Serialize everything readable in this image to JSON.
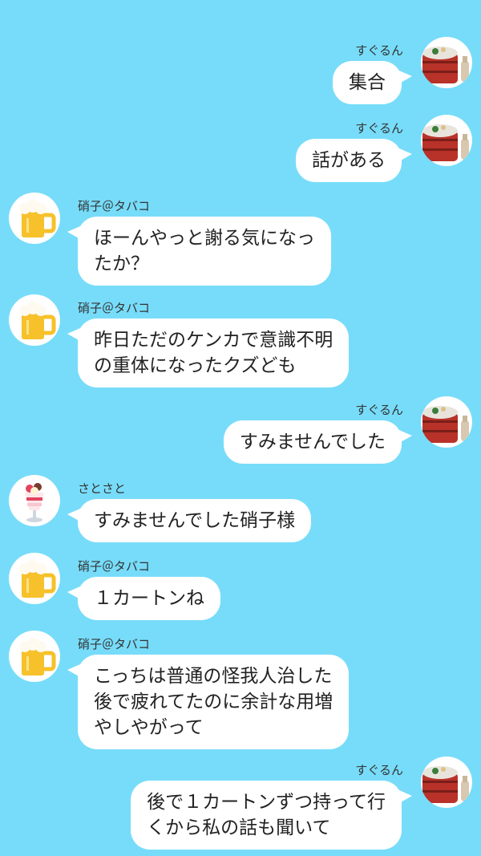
{
  "users": {
    "suguru": {
      "name": "すぐるん",
      "icon": "lacquer-box-sake-icon"
    },
    "shoko": {
      "name": "硝子＠タバコ",
      "icon": "beer-mug-icon"
    },
    "satosato": {
      "name": "さとさと",
      "icon": "parfait-icon"
    }
  },
  "messages": [
    {
      "sender": "すぐるん",
      "side": "right",
      "text": "集合"
    },
    {
      "sender": "すぐるん",
      "side": "right",
      "text": "話がある"
    },
    {
      "sender": "硝子＠タバコ",
      "side": "left",
      "text": "ほーんやっと謝る気になっ\nたか？"
    },
    {
      "sender": "硝子＠タバコ",
      "side": "left",
      "text": "昨日ただのケンカで意識不明\nの重体になったクズども"
    },
    {
      "sender": "すぐるん",
      "side": "right",
      "text": "すみませんでした"
    },
    {
      "sender": "さとさと",
      "side": "left",
      "text": "すみませんでした硝子様"
    },
    {
      "sender": "硝子＠タバコ",
      "side": "left",
      "text": "１カートンね"
    },
    {
      "sender": "硝子＠タバコ",
      "side": "left",
      "text": "こっちは普通の怪我人治した\n後で疲れてたのに余計な用増\nやしやがって"
    },
    {
      "sender": "すぐるん",
      "side": "right",
      "text": "後で１カートンずつ持って行\nくから私の話も聞いて"
    }
  ],
  "colors": {
    "background": "#77dcf9",
    "bubble": "#ffffff",
    "text": "#222222"
  }
}
